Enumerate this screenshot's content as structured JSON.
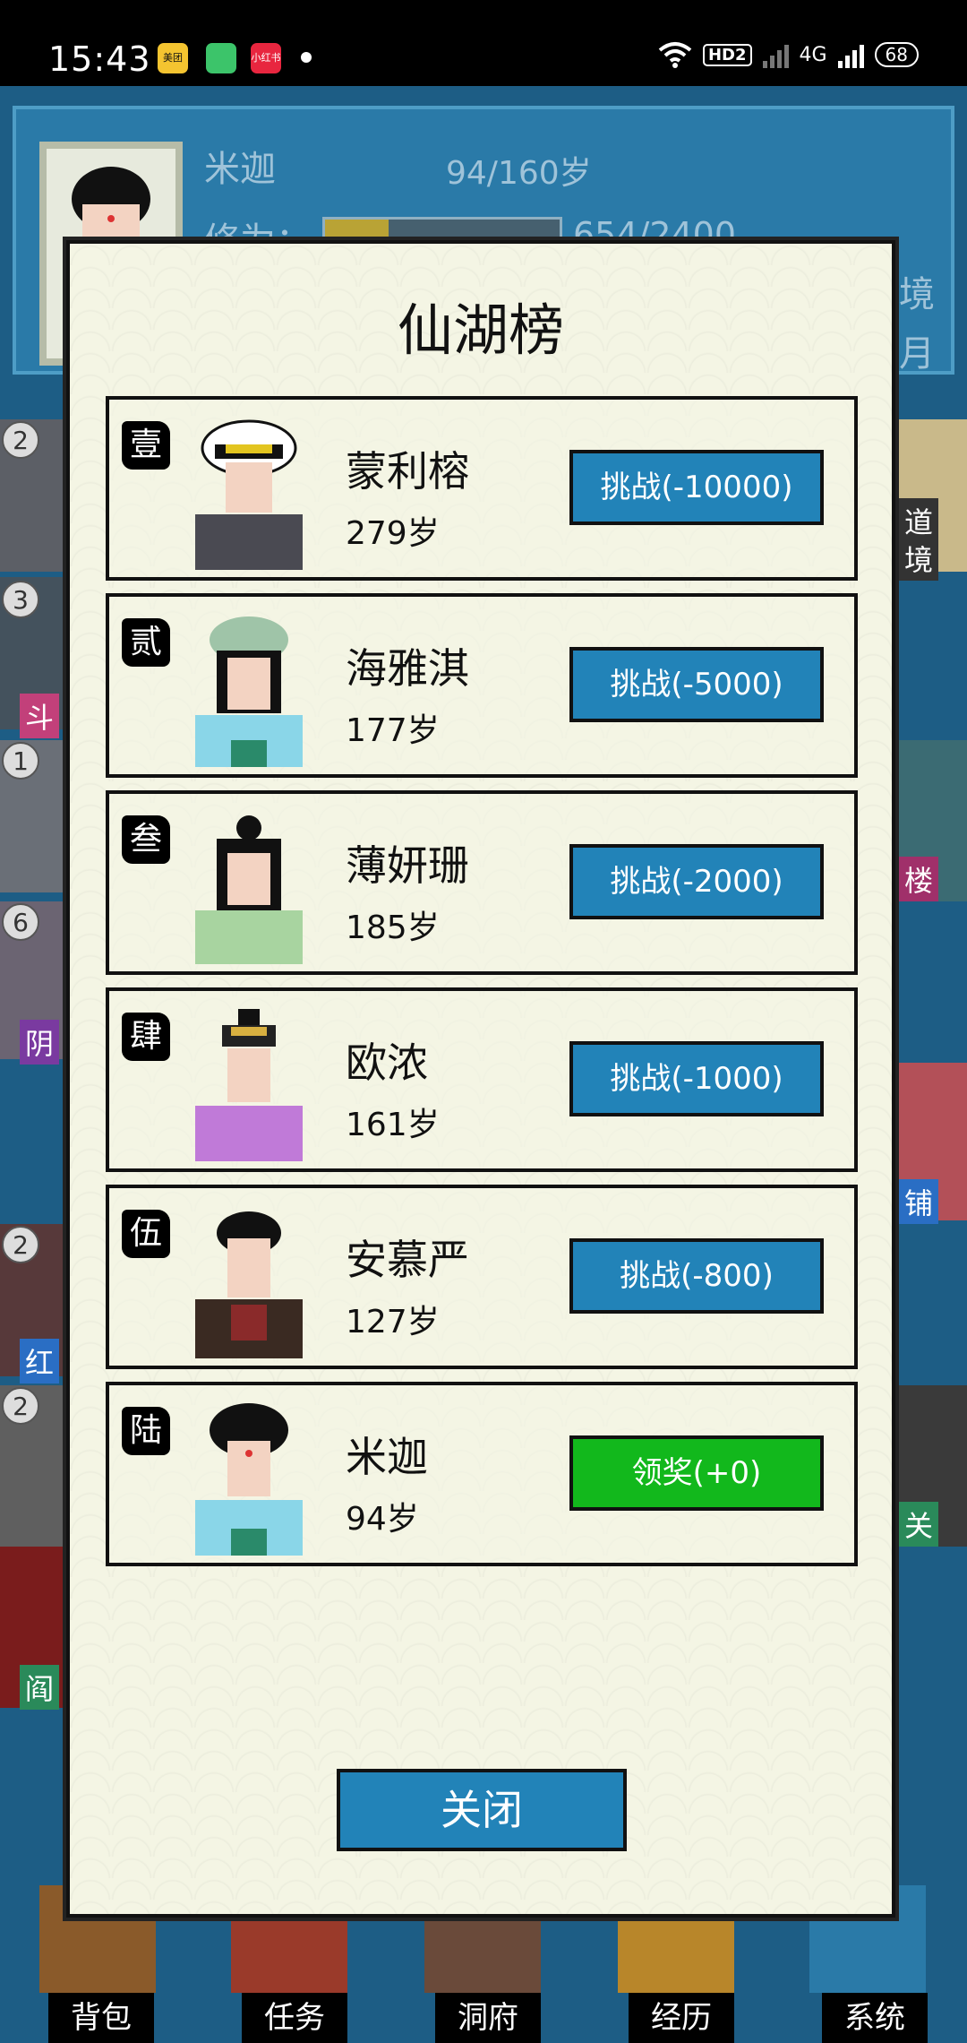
{
  "status_bar": {
    "time": "15:43",
    "app_icons": [
      {
        "name": "meituan-app-icon",
        "label": "美团",
        "color": "#f4c430"
      },
      {
        "name": "green-app-icon",
        "label": "",
        "color": "#3cc46a"
      },
      {
        "name": "xiaohongshu-app-icon",
        "label": "小红书",
        "color": "#e8263f"
      }
    ],
    "hd_label": "HD2",
    "network_label": "4G",
    "battery": "68"
  },
  "header": {
    "player_name": "米迦",
    "age": "94/160岁",
    "cultivation_label": "修为：",
    "exp": "654/2400",
    "exp_progress": 0.27,
    "realm_suffix": "境",
    "month_suffix": "月"
  },
  "side_tags": {
    "left": [
      "斗",
      "阴",
      "红",
      "阎"
    ],
    "right": [
      "道",
      "境",
      "楼",
      "铺",
      "关"
    ]
  },
  "side_badges": [
    "2",
    "3",
    "1",
    "6",
    "2",
    "2"
  ],
  "modal": {
    "title": "仙湖榜",
    "entries": [
      {
        "rank": "壹",
        "name": "蒙利榕",
        "age": "279岁",
        "button": "挑战(-10000)",
        "type": "challenge"
      },
      {
        "rank": "贰",
        "name": "海雅淇",
        "age": "177岁",
        "button": "挑战(-5000)",
        "type": "challenge"
      },
      {
        "rank": "叁",
        "name": "薄妍珊",
        "age": "185岁",
        "button": "挑战(-2000)",
        "type": "challenge"
      },
      {
        "rank": "肆",
        "name": "欧浓",
        "age": "161岁",
        "button": "挑战(-1000)",
        "type": "challenge"
      },
      {
        "rank": "伍",
        "name": "安慕严",
        "age": "127岁",
        "button": "挑战(-800)",
        "type": "challenge"
      },
      {
        "rank": "陆",
        "name": "米迦",
        "age": "94岁",
        "button": "领奖(+0)",
        "type": "claim"
      }
    ],
    "close_label": "关闭"
  },
  "bottom_nav": [
    "背包",
    "任务",
    "洞府",
    "经历",
    "系统"
  ],
  "colors": {
    "challenge_button": "#2283b8",
    "claim_button": "#12b81c",
    "modal_bg": "#f4f5e4",
    "game_bg": "#1d5d85"
  }
}
